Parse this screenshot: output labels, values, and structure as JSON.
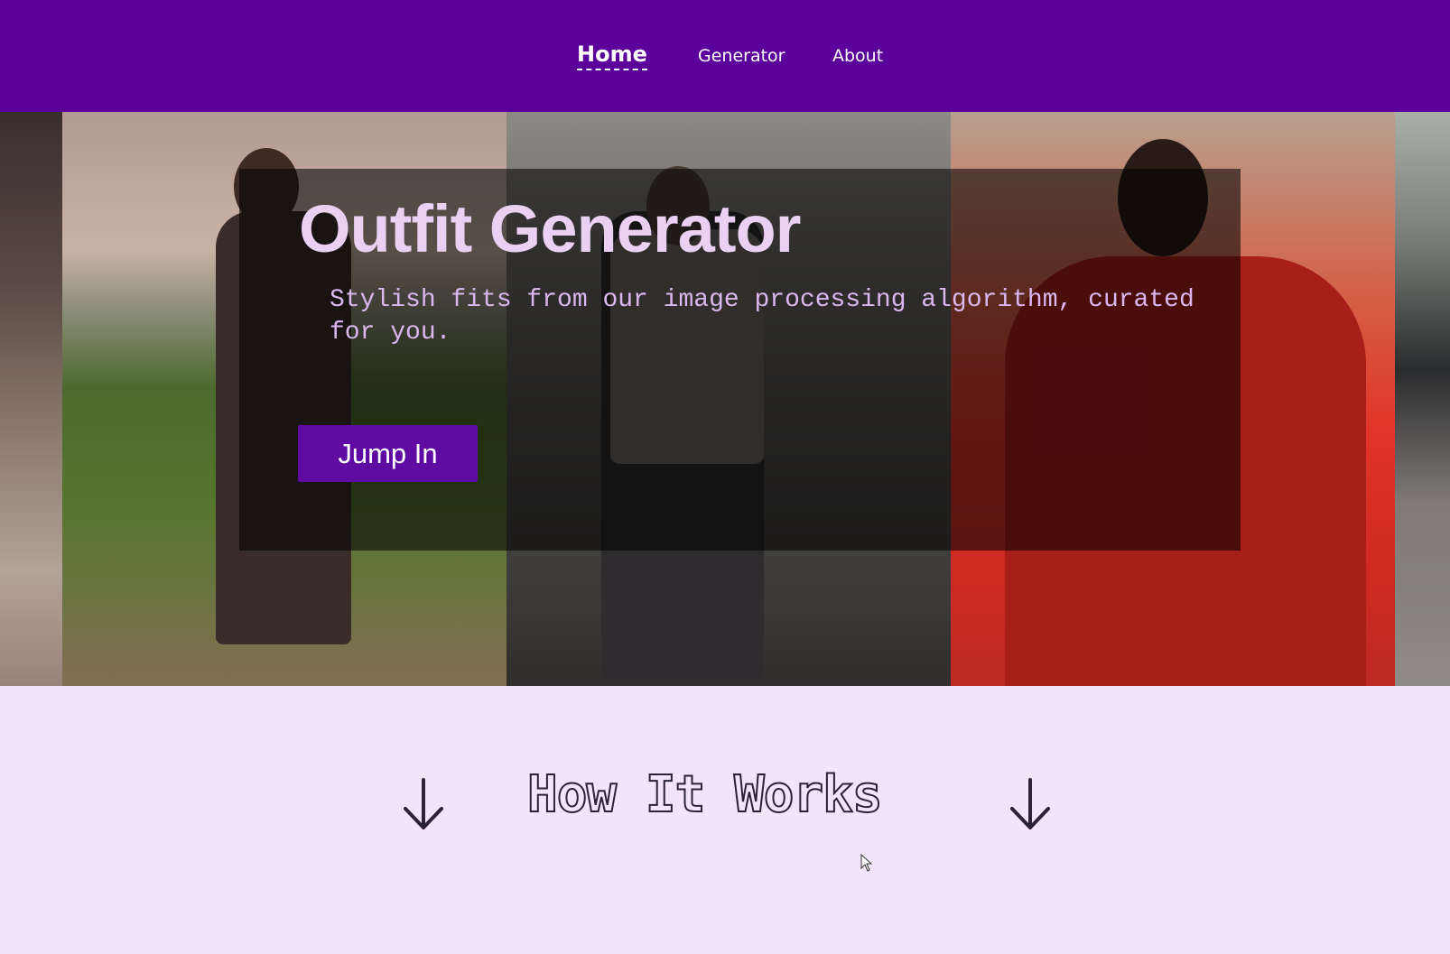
{
  "nav": {
    "items": [
      {
        "label": "Home",
        "active": true
      },
      {
        "label": "Generator",
        "active": false
      },
      {
        "label": "About",
        "active": false
      }
    ]
  },
  "hero": {
    "title": "Outfit Generator",
    "subtitle": "Stylish fits from our image processing algorithm, curated for you.",
    "cta_label": "Jump In"
  },
  "section": {
    "title": "How It Works",
    "arrow_icon": "arrow-down-icon"
  },
  "colors": {
    "nav_bg": "#5b009a",
    "page_bg": "#f2e4fb",
    "button_bg": "#5f0aa3",
    "title_color": "#ead1f3"
  }
}
